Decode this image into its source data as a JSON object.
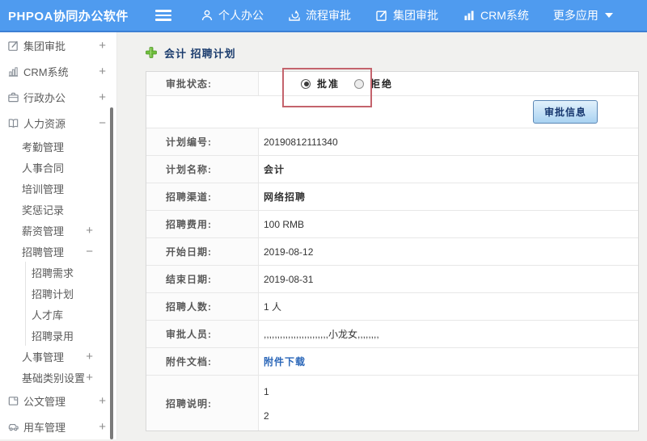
{
  "colors": {
    "header_blue": "#4f9bef",
    "header_border_blue": "#3c7fd4",
    "annotation_red": "#c4636c",
    "link_blue": "#2a66b8",
    "title_navy": "#1c3d6e",
    "plus_green": "#66bb33",
    "button_face": "#a9d2f1"
  },
  "header": {
    "logo": "PHPOA协同办公软件",
    "nav": [
      {
        "label": "个人办公",
        "icon": "user-icon"
      },
      {
        "label": "流程审批",
        "icon": "process-icon"
      },
      {
        "label": "集团审批",
        "icon": "edit-icon"
      },
      {
        "label": "CRM系统",
        "icon": "chart-icon"
      },
      {
        "label": "更多应用",
        "icon": "caret-down-icon"
      }
    ]
  },
  "sidebar": {
    "items": [
      {
        "label": "集团审批",
        "level": 1,
        "icon": "edit-icon",
        "expander": "+"
      },
      {
        "label": "CRM系统",
        "level": 1,
        "icon": "chart-icon",
        "expander": "+"
      },
      {
        "label": "行政办公",
        "level": 1,
        "icon": "briefcase-icon",
        "expander": "+"
      },
      {
        "label": "人力资源",
        "level": 1,
        "icon": "book-icon",
        "expander": "−"
      },
      {
        "label": "考勤管理",
        "level": 2,
        "expander": ""
      },
      {
        "label": "人事合同",
        "level": 2,
        "expander": ""
      },
      {
        "label": "培训管理",
        "level": 2,
        "expander": ""
      },
      {
        "label": "奖惩记录",
        "level": 2,
        "expander": ""
      },
      {
        "label": "薪资管理",
        "level": 2,
        "expander": "+"
      },
      {
        "label": "招聘管理",
        "level": 2,
        "expander": "−"
      },
      {
        "label": "招聘需求",
        "level": 3,
        "expander": ""
      },
      {
        "label": "招聘计划",
        "level": 3,
        "expander": ""
      },
      {
        "label": "人才库",
        "level": 3,
        "expander": ""
      },
      {
        "label": "招聘录用",
        "level": 3,
        "expander": ""
      },
      {
        "label": "人事管理",
        "level": 2,
        "expander": "+"
      },
      {
        "label": "基础类别设置",
        "level": 2,
        "expander": "+"
      },
      {
        "label": "公文管理",
        "level": 1,
        "icon": "document-icon",
        "expander": "+"
      },
      {
        "label": "用车管理",
        "level": 1,
        "icon": "car-icon",
        "expander": "+"
      }
    ]
  },
  "main": {
    "title": "会计 招聘计划",
    "status": {
      "label": "审批状态:",
      "options": [
        {
          "label": "批准",
          "selected": true
        },
        {
          "label": "拒绝",
          "selected": false
        }
      ]
    },
    "button_label": "审批信息",
    "rows": [
      {
        "label": "计划编号:",
        "value": "20190812111340"
      },
      {
        "label": "计划名称:",
        "value": "会计"
      },
      {
        "label": "招聘渠道:",
        "value": "网络招聘"
      },
      {
        "label": "招聘费用:",
        "value": "100 RMB"
      },
      {
        "label": "开始日期:",
        "value": "2019-08-12"
      },
      {
        "label": "结束日期:",
        "value": "2019-08-31"
      },
      {
        "label": "招聘人数:",
        "value": "1 人"
      },
      {
        "label": "审批人员:",
        "value": ",,,,,,,,,,,,,,,,,,,,,,,,小龙女,,,,,,,,"
      },
      {
        "label": "附件文档:",
        "value": "附件下载",
        "link": true
      },
      {
        "label": "招聘说明:",
        "lines": [
          "1",
          "2"
        ]
      }
    ]
  }
}
